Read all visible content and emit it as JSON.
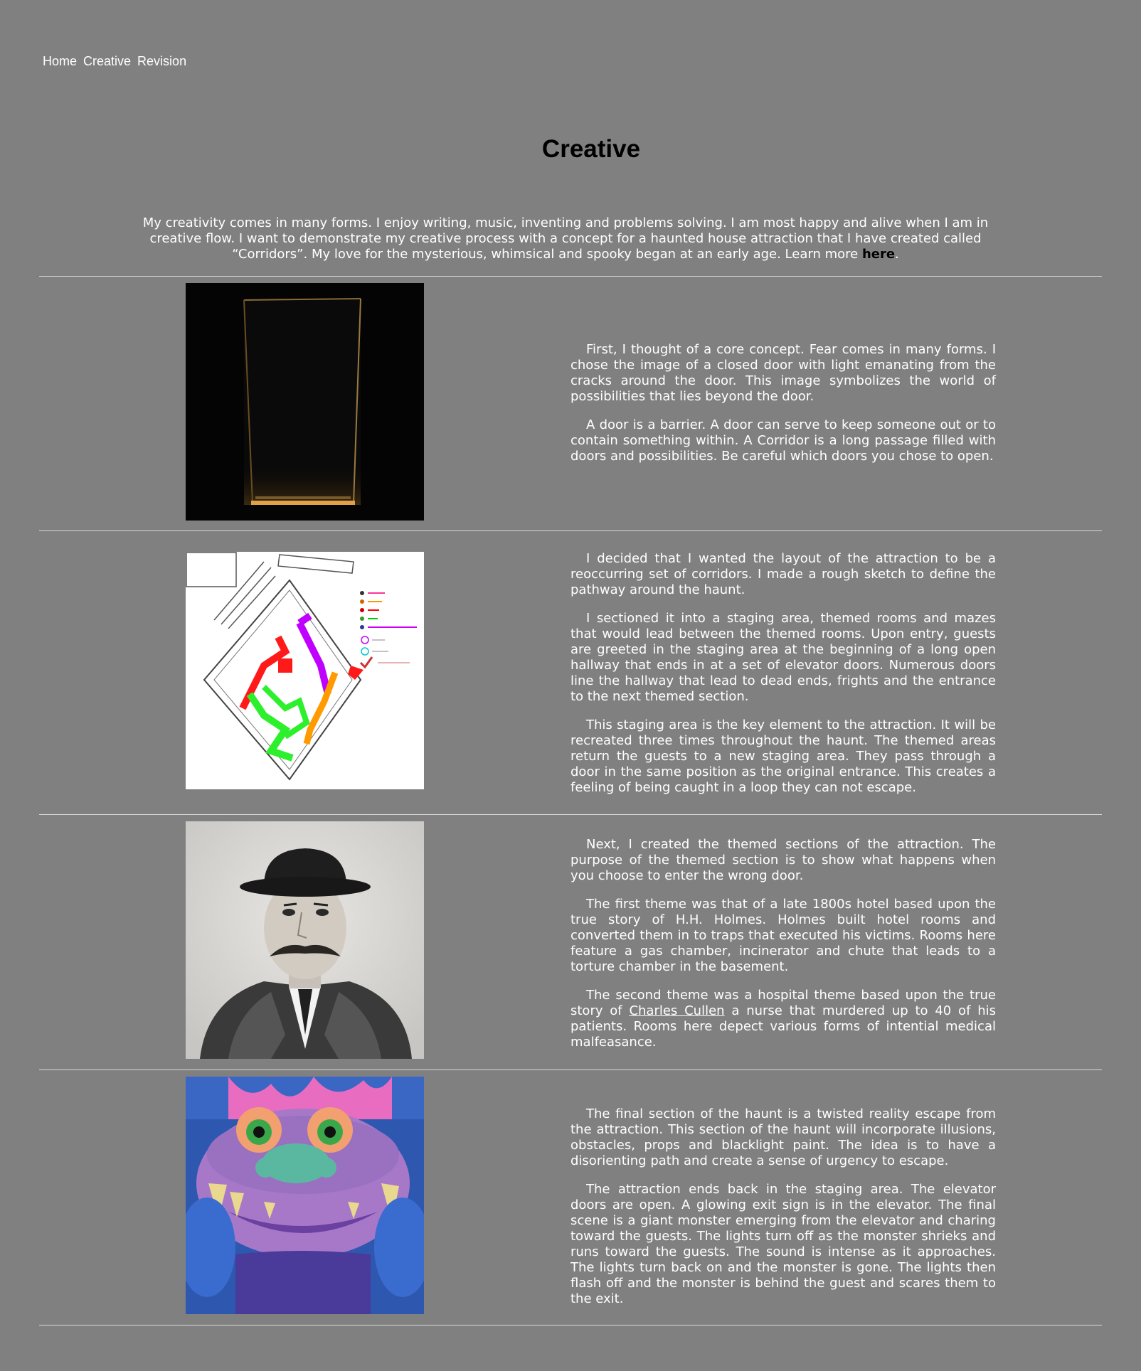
{
  "nav": {
    "items": [
      "Home",
      "Creative",
      "Revision"
    ]
  },
  "page": {
    "title": "Creative"
  },
  "intro": {
    "text": "My creativity comes in many forms. I enjoy writing, music, inventing and problems solving. I am most happy and alive when I am in creative flow. I want to demonstrate my creative process with a concept for a haunted house attraction that I have created called “Corridors”. My love for the mysterious, whimsical and spooky began at an early age. Learn more ",
    "link_label": "here",
    "end_punct": "."
  },
  "sections": [
    {
      "image": "dark-door-image",
      "paragraphs": [
        "First, I thought of a core concept. Fear comes in many forms. I chose the image of a closed door with light emanating from the cracks around the door. This image symbolizes the world of possibilities that lies beyond the door.",
        "A door is a barrier. A door can serve to keep someone out or to contain something within. A Corridor is a long passage filled with doors and possibilities. Be careful which doors you chose to open."
      ]
    },
    {
      "image": "layout-sketch-image",
      "paragraphs": [
        "I decided that I wanted the layout of the attraction to be a reoccurring set of corridors. I made a rough sketch to define the pathway around the haunt.",
        "I sectioned it into a staging area, themed rooms and mazes that would lead between the themed rooms. Upon entry, guests are greeted in the staging area at the beginning of a long open hallway that ends in at a set of elevator doors. Numerous doors line the hallway that lead to dead ends, frights and the entrance to the next themed section.",
        "This staging area is the key element to the attraction. It will be recreated three times throughout the haunt. The themed areas return the guests to a new staging area. They pass through a door in the same position as the original entrance. This creates a feeling of being caught in a loop they can not escape."
      ]
    },
    {
      "image": "vintage-portrait-image",
      "paragraphs": [
        "Next, I created the themed sections of the attraction. The purpose of the themed section is to show what happens when you choose to enter the wrong door.",
        "The first theme was that of a late 1800s hotel based upon the true story of H.H. Holmes. Holmes built hotel rooms and converted them in to traps that executed his victims. Rooms here feature a gas chamber, incinerator and chute that leads to a torture chamber in the basement."
      ],
      "link_paragraph": {
        "before": "The second theme was a hospital theme based upon the true story of ",
        "link_label": "Charles Cullen",
        "after": " a nurse that murdered up to 40 of his patients. Rooms here depect various forms of intential medical malfeasance."
      }
    },
    {
      "image": "purple-monster-image",
      "paragraphs": [
        "The final section of the haunt is a twisted reality escape from the attraction. This section of the haunt will incorporate illusions, obstacles, props and blacklight paint. The idea is to have a disorienting path and create a sense of urgency to escape.",
        "The attraction ends back in the staging area. The elevator doors are open. A glowing exit sign is in the elevator. The final scene is a giant monster emerging from the elevator and charing toward the guests. The lights turn off as the monster shrieks and runs toward the guests. The sound is intense as it approaches. The lights turn back on and the monster is gone. The lights then flash off and the monster is behind the guest and scares them to the exit."
      ]
    }
  ],
  "colors": {
    "background": "#808080",
    "text": "#ffffff",
    "title": "#000000",
    "divider": "#d8d8d8"
  }
}
